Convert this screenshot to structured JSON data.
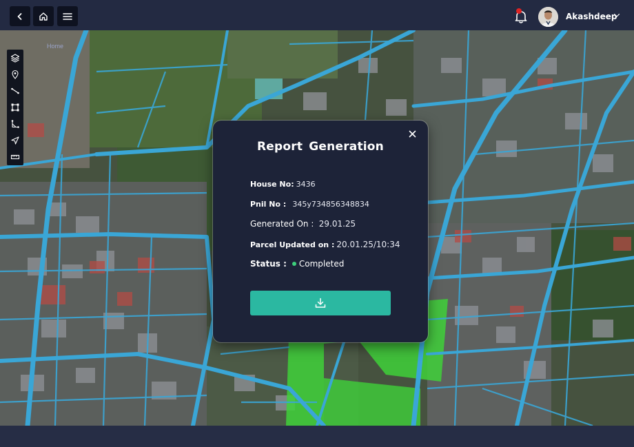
{
  "header": {
    "username": "Akashdeep",
    "notifications_unread": true
  },
  "map": {
    "breadcrumb": "Home",
    "tools": [
      "layers-icon",
      "pin-icon",
      "line-icon",
      "polygon-icon",
      "path-icon",
      "navigate-icon",
      "ruler-icon"
    ]
  },
  "modal": {
    "title": "Report  Generation",
    "fields": {
      "house_no_label": "House No:",
      "house_no_value": "3436",
      "pnil_no_label": "Pnil No :",
      "pnil_no_value": "345y734856348834",
      "generated_on_label": "Generated On :",
      "generated_on_value": "29.01.25",
      "parcel_updated_label": "Parcel Updated on :",
      "parcel_updated_value": "20.01.25/10:34",
      "status_label": "Status :",
      "status_value": "Completed"
    },
    "status_color": "#3ecf7c",
    "button_color": "#2bb8a1"
  },
  "colors": {
    "topbar": "#232a42",
    "road": "#3aa6d6",
    "highlight_parcel": "#3fd13a"
  }
}
